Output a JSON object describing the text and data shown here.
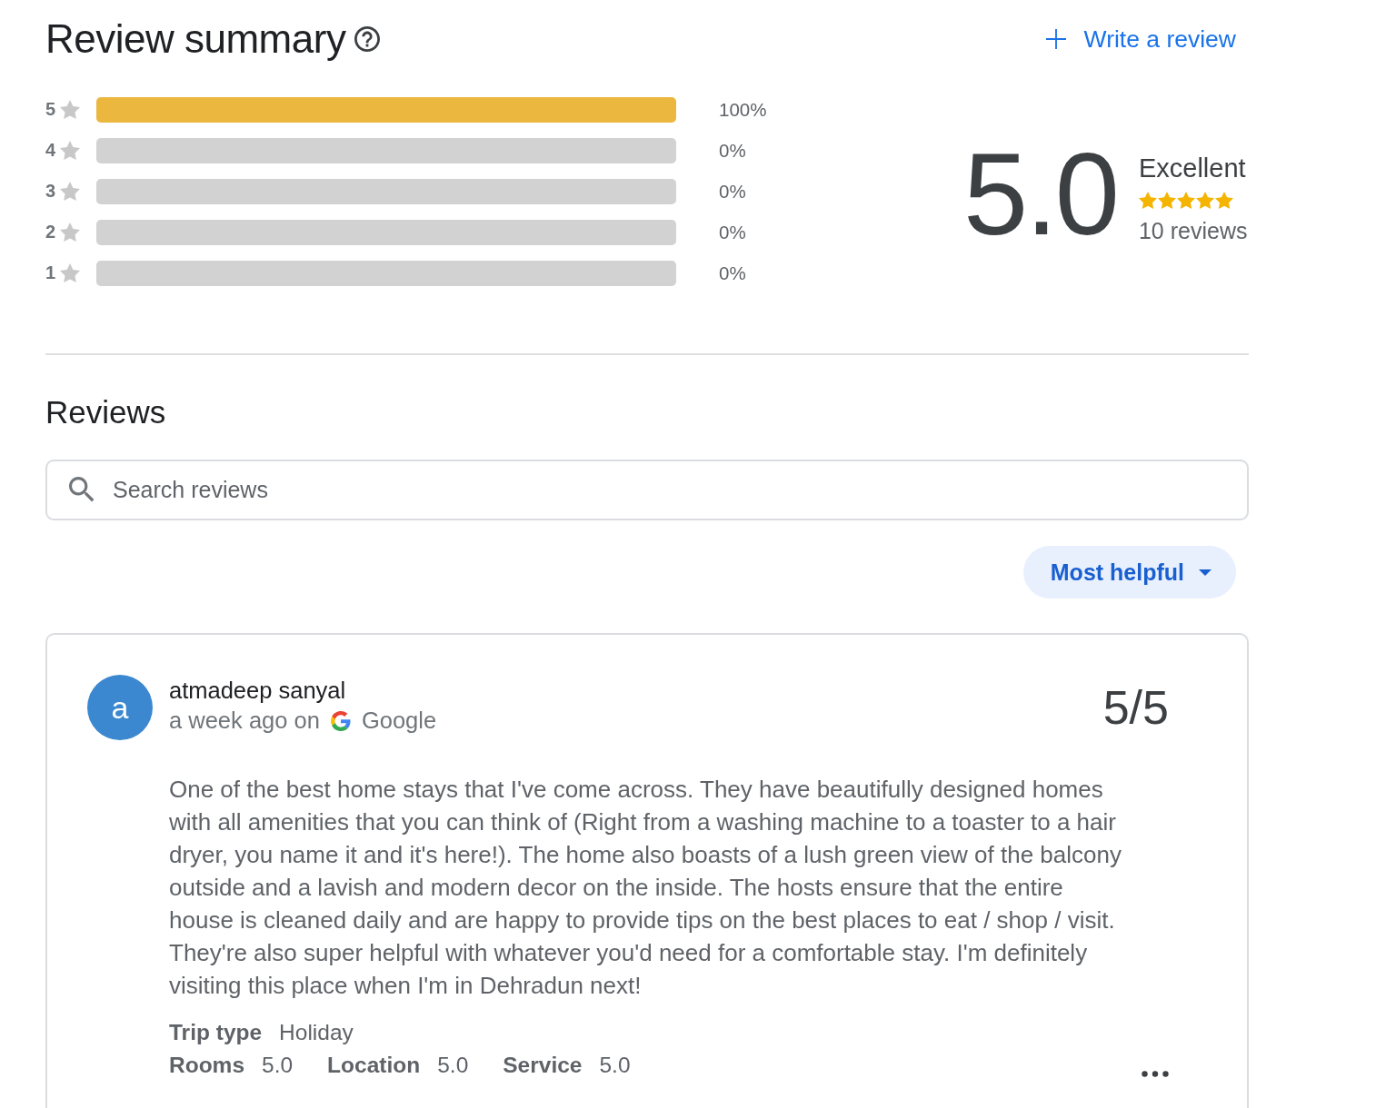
{
  "header": {
    "title": "Review summary",
    "write_review": "Write a review"
  },
  "distribution": [
    {
      "label": "5",
      "level": 1,
      "percent": "100%"
    },
    {
      "label": "4",
      "level": 0,
      "percent": "0%"
    },
    {
      "label": "3",
      "level": 0,
      "percent": "0%"
    },
    {
      "label": "2",
      "level": 0,
      "percent": "0%"
    },
    {
      "label": "1",
      "level": 0,
      "percent": "0%"
    }
  ],
  "overall": {
    "score": "5.0",
    "rating_label": "Excellent",
    "stars": 5,
    "count": "10 reviews"
  },
  "reviews_section": {
    "title": "Reviews",
    "search": {
      "placeholder": "Search reviews"
    },
    "sort": {
      "label": "Most helpful"
    }
  },
  "reviews": [
    {
      "avatar_letter": "a",
      "author": "atmadeep sanyal",
      "time": "a week ago on",
      "source": "Google",
      "score": "5/5",
      "text": "One of the best home stays that I've come across. They have beautifully designed homes with all amenities that you can think of (Right from a washing machine to a toaster to a hair dryer, you name it and it's here!). The home also boasts of a lush green view of the balcony outside and a lavish and modern decor on the inside. The hosts ensure that the entire house is cleaned daily and are happy to provide tips on the best places to eat / shop / visit. They're also super helpful with whatever you'd need for a comfortable stay. I'm definitely visiting this place when I'm in Dehradun next!",
      "trip": {
        "label": "Trip type",
        "value": "Holiday"
      },
      "ratings": [
        {
          "label": "Rooms",
          "value": "5.0"
        },
        {
          "label": "Location",
          "value": "5.0"
        },
        {
          "label": "Service",
          "value": "5.0"
        }
      ]
    }
  ]
}
